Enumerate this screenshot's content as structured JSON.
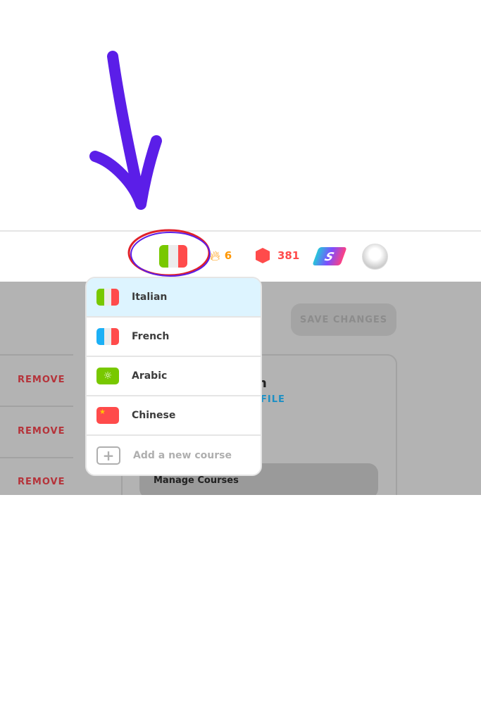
{
  "header": {
    "current_course": "Italian",
    "streak": "6",
    "gems": "381",
    "super_label": "S"
  },
  "menu": {
    "items": [
      {
        "label": "Italian",
        "selected": true
      },
      {
        "label": "French"
      },
      {
        "label": "Arabic"
      },
      {
        "label": "Chinese"
      }
    ],
    "add_label": "Add a new course"
  },
  "background": {
    "save_label": "SAVE CHANGES",
    "remove_label": "REMOVE",
    "name_fragment": "n",
    "profile_fragment": "FILE",
    "manage_label": "Manage Courses"
  },
  "annotation": {
    "arrow_color": "#5b1ee8",
    "circle_color": "#e0202a"
  }
}
